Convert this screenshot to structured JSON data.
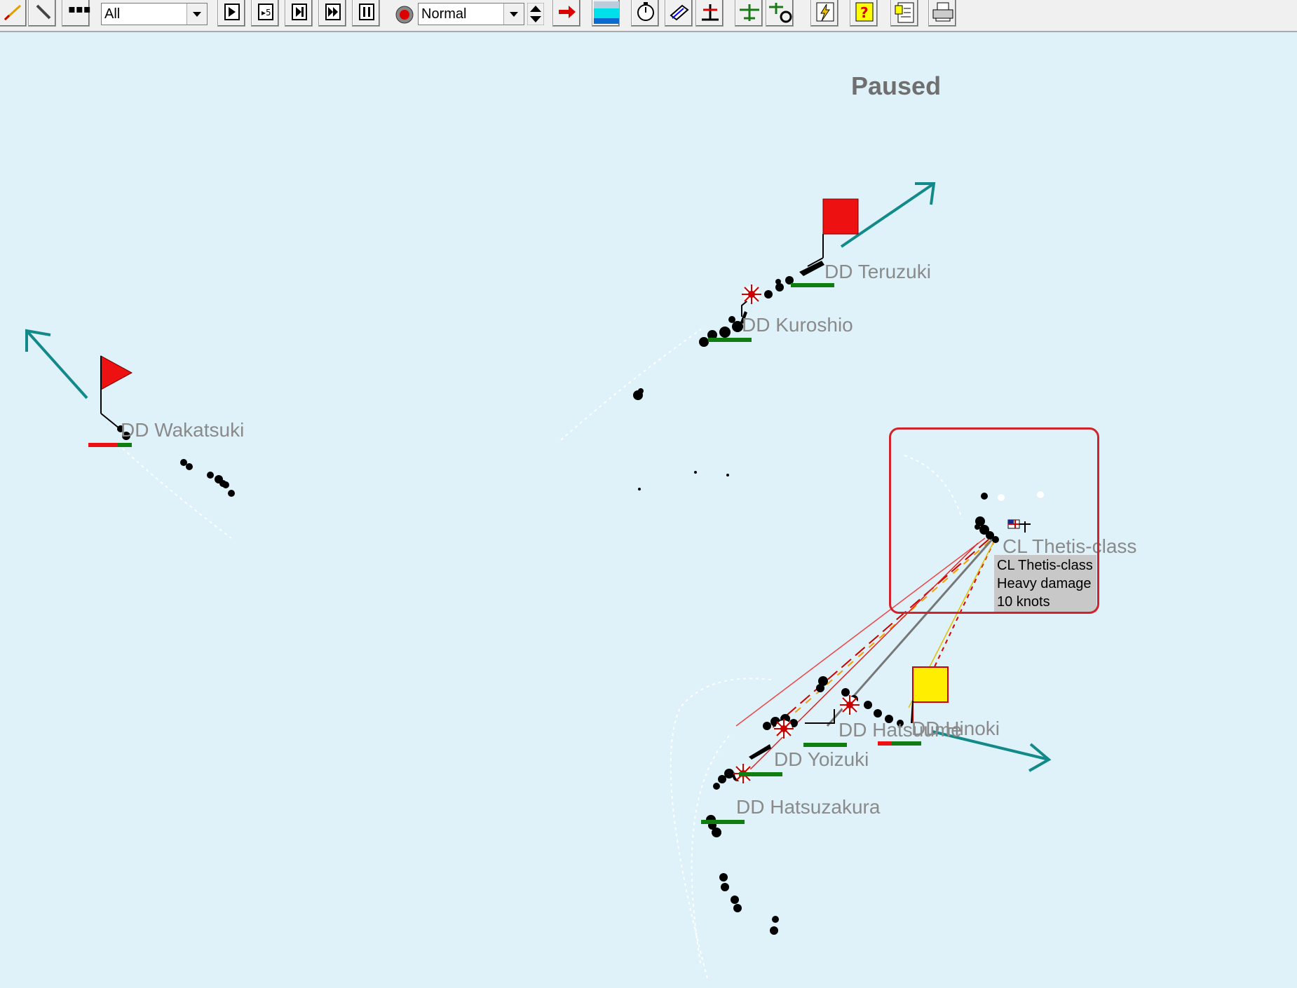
{
  "toolbar": {
    "filter_value": "All",
    "speed_value": "Normal",
    "buttons": [
      "pencil-icon",
      "feather-icon",
      "dots-icon",
      "play-icon",
      "play-5-icon",
      "step-icon",
      "fast-forward-icon",
      "pause-icon",
      "record-icon",
      "spin-icon",
      "red-arrow-icon",
      "water-icon",
      "stopwatch-icon",
      "book-icon",
      "anchor-icon",
      "aircraft-icon",
      "gear-aircraft-icon",
      "lightning-icon",
      "help-icon",
      "notes-icon",
      "printer-icon"
    ]
  },
  "status": "Paused",
  "ships": {
    "teruzuki": "DD Teruzuki",
    "kuroshio": "DD Kuroshio",
    "wakatsuki": "DD Wakatsuki",
    "thetis": "CL Thetis-class",
    "hatsuume": "DD Hatsuume",
    "hinoki": "DD Hinoki",
    "yoizuki": "DD Yoizuki",
    "hatsuzakura": "DD Hatsuzakura"
  },
  "tooltip": {
    "line1": "CL Thetis-class",
    "line2": "Heavy damage",
    "line3": "10 knots"
  },
  "colors": {
    "water": "#dff2f9",
    "heading_arrow": "#138a8a",
    "flag_red": "#ee1111",
    "flag_yellow": "#ffee00",
    "health_green": "#0f7d0f",
    "health_red": "#ee1111",
    "highlight": "#d0232b"
  }
}
